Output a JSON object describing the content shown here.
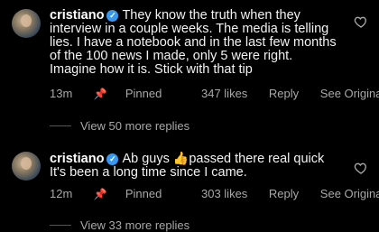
{
  "comments": [
    {
      "username": "cristiano",
      "text": "They know the truth when they interview in a couple weeks. The media is telling lies. I have a notebook and in the last few months of the 100 news I made, only 5 were right. Imagine how it is. Stick with that tip",
      "time": "13m",
      "pinned_label": "Pinned",
      "likes": "347 likes",
      "reply_label": "Reply",
      "see_original_label": "See Original",
      "view_replies": "View 50 more replies"
    },
    {
      "username": "cristiano",
      "text_before_emoji": "Ab guys",
      "emoji": "👍",
      "text_after_emoji": "passed there real quick It's been a long time since I came.",
      "time": "12m",
      "pinned_label": "Pinned",
      "likes": "303 likes",
      "reply_label": "Reply",
      "see_original_label": "See Original",
      "view_replies": "View 33 more replies"
    }
  ],
  "icons": {
    "verified": "verified-badge-icon",
    "pin": "pin-icon",
    "like": "heart-icon"
  },
  "colors": {
    "background": "#000000",
    "verified_blue": "#3897f0",
    "muted_text": "#a8a8a8"
  }
}
